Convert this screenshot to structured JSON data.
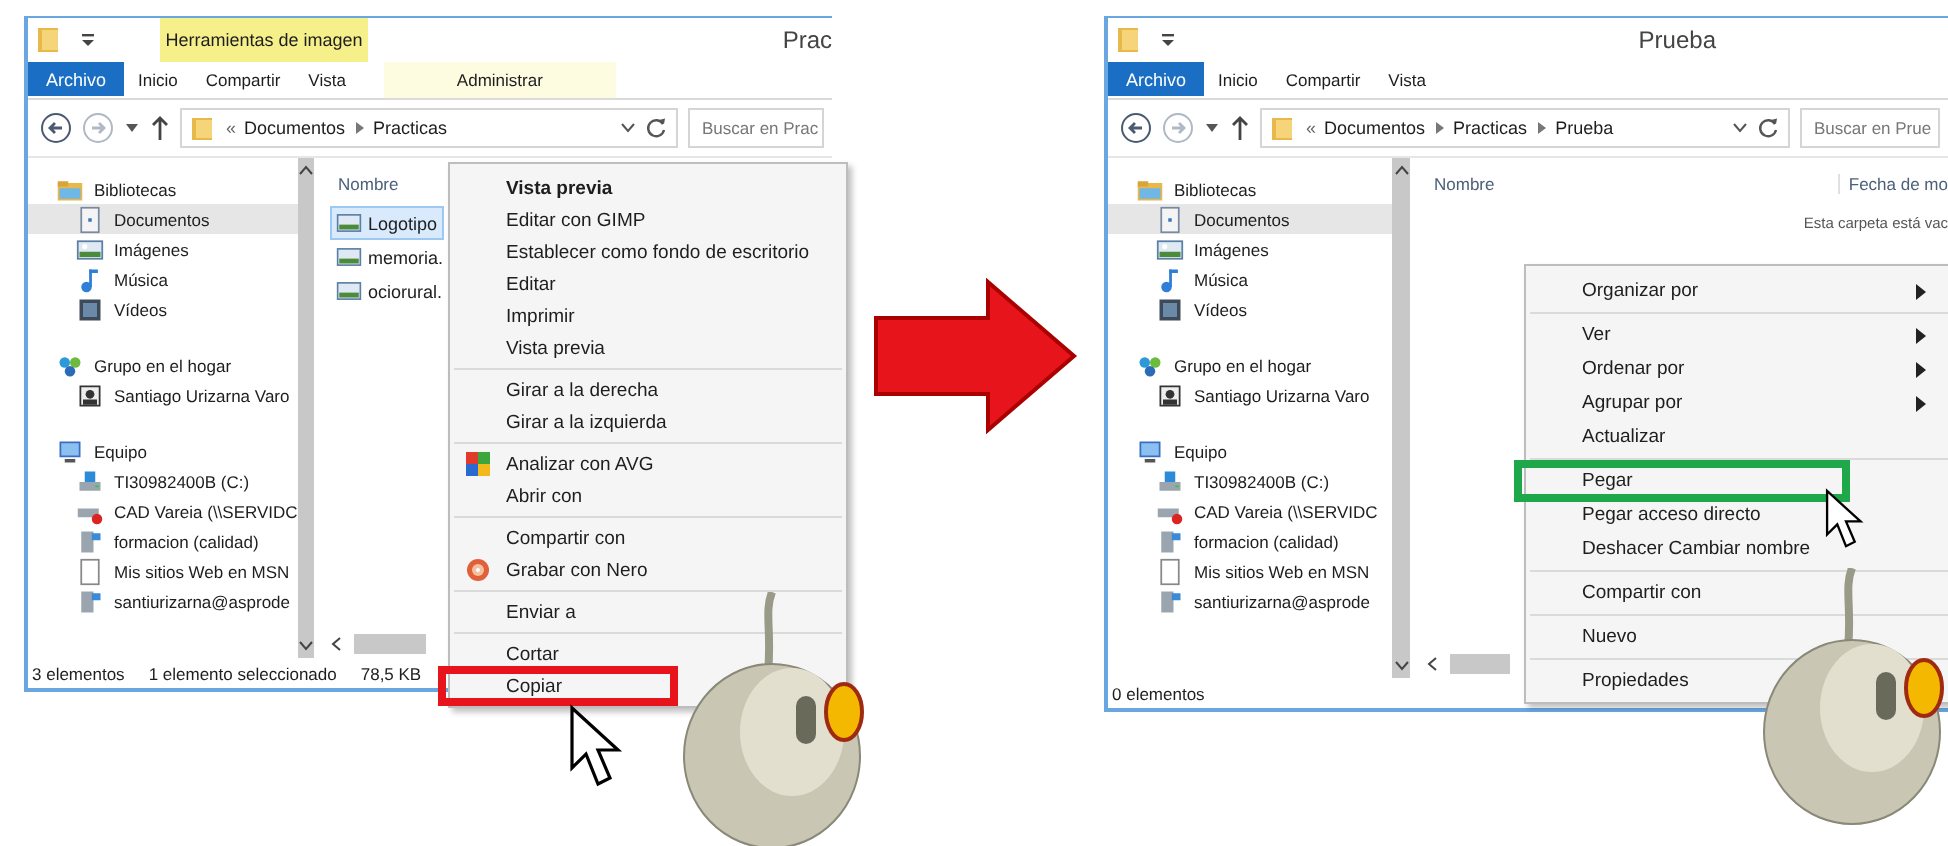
{
  "panels": [
    {
      "title": "Prac",
      "context_title": "Herramientas de imagen",
      "ribbon_tabs": [
        {
          "label": "Archivo",
          "kind": "file"
        },
        {
          "label": "Inicio",
          "kind": "normal"
        },
        {
          "label": "Compartir",
          "kind": "normal"
        },
        {
          "label": "Vista",
          "kind": "normal"
        },
        {
          "label": "Administrar",
          "kind": "context"
        }
      ],
      "path_overflow": "«",
      "path": [
        "Documentos",
        "Practicas"
      ],
      "search_placeholder": "Buscar en Prac",
      "nav": [
        {
          "label": "Bibliotecas",
          "kind": "library",
          "children": [
            {
              "label": "Documentos",
              "kind": "documents",
              "selected": true
            },
            {
              "label": "Imágenes",
              "kind": "pictures",
              "selected": false
            },
            {
              "label": "Música",
              "kind": "music",
              "selected": false
            },
            {
              "label": "Vídeos",
              "kind": "videos",
              "selected": false
            }
          ]
        },
        {
          "label": "Grupo en el hogar",
          "kind": "homegroup",
          "children": [
            {
              "label": "Santiago Urizarna Varo",
              "kind": "user",
              "selected": false
            }
          ]
        },
        {
          "label": "Equipo",
          "kind": "computer",
          "children": [
            {
              "label": "TI30982400B (C:)",
              "kind": "drive",
              "selected": false
            },
            {
              "label": "CAD Vareia (\\\\SERVIDC",
              "kind": "network-drive-offline",
              "selected": false
            },
            {
              "label": "formacion (calidad)",
              "kind": "network-drive",
              "selected": false
            },
            {
              "label": "Mis sitios Web en MSN",
              "kind": "web-page",
              "selected": false
            },
            {
              "label": "santiurizarna@asprode",
              "kind": "network-drive",
              "selected": false
            }
          ]
        }
      ],
      "columns": [
        "Nombre"
      ],
      "files": [
        {
          "name": "Logotipo",
          "selected": true
        },
        {
          "name": "memoria.",
          "selected": false
        },
        {
          "name": "ociorural.",
          "selected": false
        }
      ],
      "status": [
        "3 elementos",
        "1 elemento seleccionado",
        "78,5 KB"
      ],
      "menu": [
        [
          {
            "label": "Vista previa",
            "bold": true
          },
          {
            "label": "Editar con GIMP"
          },
          {
            "label": "Establecer como fondo de escritorio"
          },
          {
            "label": "Editar"
          },
          {
            "label": "Imprimir"
          },
          {
            "label": "Vista previa"
          }
        ],
        [
          {
            "label": "Girar a la derecha"
          },
          {
            "label": "Girar a la izquierda"
          }
        ],
        [
          {
            "label": "Analizar con AVG",
            "kind": "tiles"
          },
          {
            "label": "Abrir con",
            "kind": "plain"
          }
        ],
        [
          {
            "label": "Compartir con",
            "kind": "plain"
          },
          {
            "label": "Grabar con Nero",
            "kind": "disc"
          }
        ],
        [
          {
            "label": "Enviar a"
          }
        ],
        [
          {
            "label": "Cortar"
          },
          {
            "label": "Copiar",
            "highlighted": true
          }
        ]
      ]
    },
    {
      "title": "Prueba",
      "ribbon_tabs": [
        {
          "label": "Archivo",
          "kind": "file"
        },
        {
          "label": "Inicio",
          "kind": "normal"
        },
        {
          "label": "Compartir",
          "kind": "normal"
        },
        {
          "label": "Vista",
          "kind": "normal"
        }
      ],
      "path_overflow": "«",
      "path": [
        "Documentos",
        "Practicas",
        "Prueba"
      ],
      "search_placeholder": "Buscar en Prue",
      "nav": [
        {
          "label": "Bibliotecas",
          "kind": "library",
          "children": [
            {
              "label": "Documentos",
              "kind": "documents",
              "selected": true
            },
            {
              "label": "Imágenes",
              "kind": "pictures",
              "selected": false
            },
            {
              "label": "Música",
              "kind": "music",
              "selected": false
            },
            {
              "label": "Vídeos",
              "kind": "videos",
              "selected": false
            }
          ]
        },
        {
          "label": "Grupo en el hogar",
          "kind": "homegroup",
          "children": [
            {
              "label": "Santiago Urizarna Varo",
              "kind": "user",
              "selected": false
            }
          ]
        },
        {
          "label": "Equipo",
          "kind": "computer",
          "children": [
            {
              "label": "TI30982400B (C:)",
              "kind": "drive",
              "selected": false
            },
            {
              "label": "CAD Vareia (\\\\SERVIDC",
              "kind": "network-drive-offline",
              "selected": false
            },
            {
              "label": "formacion (calidad)",
              "kind": "network-drive",
              "selected": false
            },
            {
              "label": "Mis sitios Web en MSN",
              "kind": "web-page",
              "selected": false
            },
            {
              "label": "santiurizarna@asprode",
              "kind": "network-drive",
              "selected": false
            }
          ]
        }
      ],
      "columns": [
        "Nombre",
        "Fecha de mo"
      ],
      "empty_message": "Esta carpeta está vac",
      "status": [
        "0 elementos"
      ],
      "menu": [
        [
          {
            "label": "Organizar por",
            "submenu": true
          }
        ],
        [
          {
            "label": "Ver",
            "submenu": true
          },
          {
            "label": "Ordenar por",
            "submenu": true
          },
          {
            "label": "Agrupar por",
            "submenu": true
          },
          {
            "label": "Actualizar"
          }
        ],
        [
          {
            "label": "Pegar",
            "highlighted": true
          },
          {
            "label": "Pegar acceso directo"
          },
          {
            "label": "Deshacer Cambiar nombre"
          }
        ],
        [
          {
            "label": "Compartir con"
          }
        ],
        [
          {
            "label": "Nuevo"
          }
        ],
        [
          {
            "label": "Propiedades"
          }
        ]
      ]
    }
  ]
}
